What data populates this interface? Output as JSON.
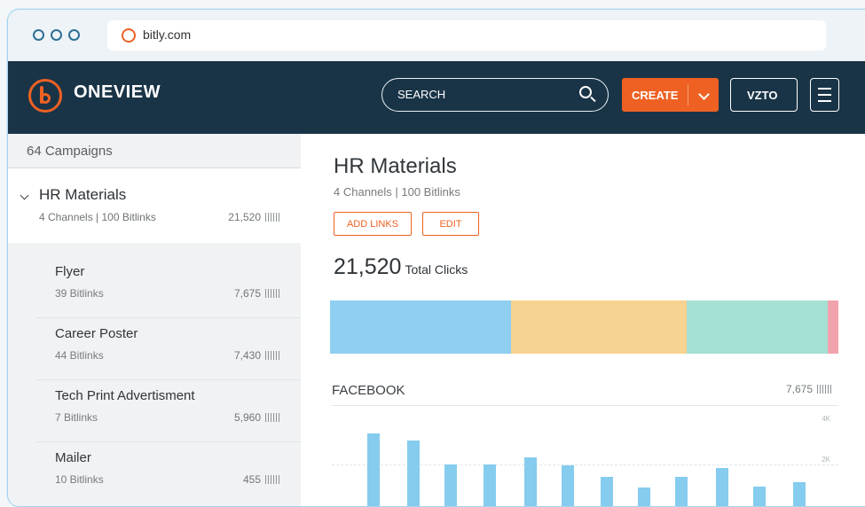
{
  "browser": {
    "url": "bitly.com"
  },
  "app": {
    "brand": "ONEVIEW",
    "search_placeholder": "SEARCH",
    "create_label": "CREATE",
    "user_label": "VZTO"
  },
  "sidebar": {
    "header": "64 Campaigns",
    "campaign": {
      "name": "HR Materials",
      "meta": "4 Channels | 100 Bitlinks",
      "clicks": "21,520"
    },
    "items": [
      {
        "name": "Flyer",
        "meta": "39 Bitlinks",
        "clicks": "7,675"
      },
      {
        "name": "Career Poster",
        "meta": "44 Bitlinks",
        "clicks": "7,430"
      },
      {
        "name": "Tech Print Advertisment",
        "meta": "7 Bitlinks",
        "clicks": "5,960"
      },
      {
        "name": "Mailer",
        "meta": "10 Bitlinks",
        "clicks": "455"
      }
    ]
  },
  "main": {
    "title": "HR Materials",
    "meta": "4 Channels | 100 Bitlinks",
    "add_links_label": "ADD LINKS",
    "edit_label": "EDIT",
    "total_clicks": "21,520",
    "total_clicks_label": "Total Clicks",
    "channel_title": "FACEBOOK",
    "channel_clicks": "7,675",
    "stack_segments": [
      {
        "value": 7675,
        "color": "#8fcff1"
      },
      {
        "value": 7430,
        "color": "#f7d391"
      },
      {
        "value": 5960,
        "color": "#a4e0d3"
      },
      {
        "value": 455,
        "color": "#f2a3ad"
      }
    ]
  },
  "chart_data": {
    "type": "bar",
    "title": "FACEBOOK",
    "y_ticks": [
      "4K",
      "2K"
    ],
    "values": [
      3500,
      3150,
      2000,
      2000,
      2350,
      1950,
      1400,
      900,
      1400,
      1850,
      950,
      1150
    ],
    "ylim": [
      0,
      4500
    ],
    "grid": true
  }
}
